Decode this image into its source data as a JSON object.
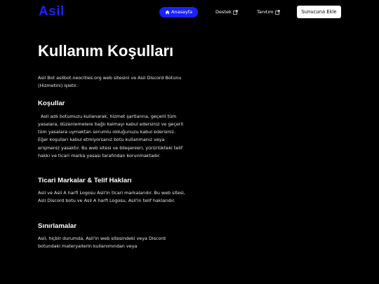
{
  "nav": {
    "logo": "Asil",
    "home_label": "Anasayfa",
    "support_label": "Destek",
    "intro_label": "Tanıtım",
    "invite_label": "Sunucuna Ekle"
  },
  "page": {
    "title": "Kullanım Koşulları",
    "intro": "Asil Bot asilbot.neocities.org web sitesini ve Asil Discord Botunu (Hizmetini) işletir.",
    "sections": [
      {
        "heading": "Koşullar",
        "body": "  Asil adlı botumuzu kullanarak, hizmet şartlarına, geçerli tüm yasalara, düzenlemelere bağlı kalmayı kabul edersiniz ve geçerli tüm yasalara uymaktan sorumlu olduğunuzu kabul edersiniz. Eğer koşulları kabul etmiyorsanız botu kullanmanız veya erişmeniz yasaktır. Bu web sitesi ve bileşenleri, yürürlükteki telif hakkı ve ticari marka yasası tarafından korunmaktadır."
      },
      {
        "heading": "Ticari Markalar & Telif Hakları",
        "body": "Asil ve Asil A harfi Logosu Asil'in ticari markalarıdır. Bu web sitesi, Asil Discord botu ve Asil A harfi Logosu, Asil'in telif haklarıdır."
      },
      {
        "heading": "Sınırlamalar",
        "body": "Asil, hiçbir durumda, Asil'in web sitesindeki veya Discord botundaki materyallerin kullanımından veya"
      }
    ]
  },
  "colors": {
    "accent": "#1a22ff",
    "background": "#000000",
    "text": "#ffffff"
  },
  "icons": [
    "home-icon",
    "external-link-icon"
  ]
}
